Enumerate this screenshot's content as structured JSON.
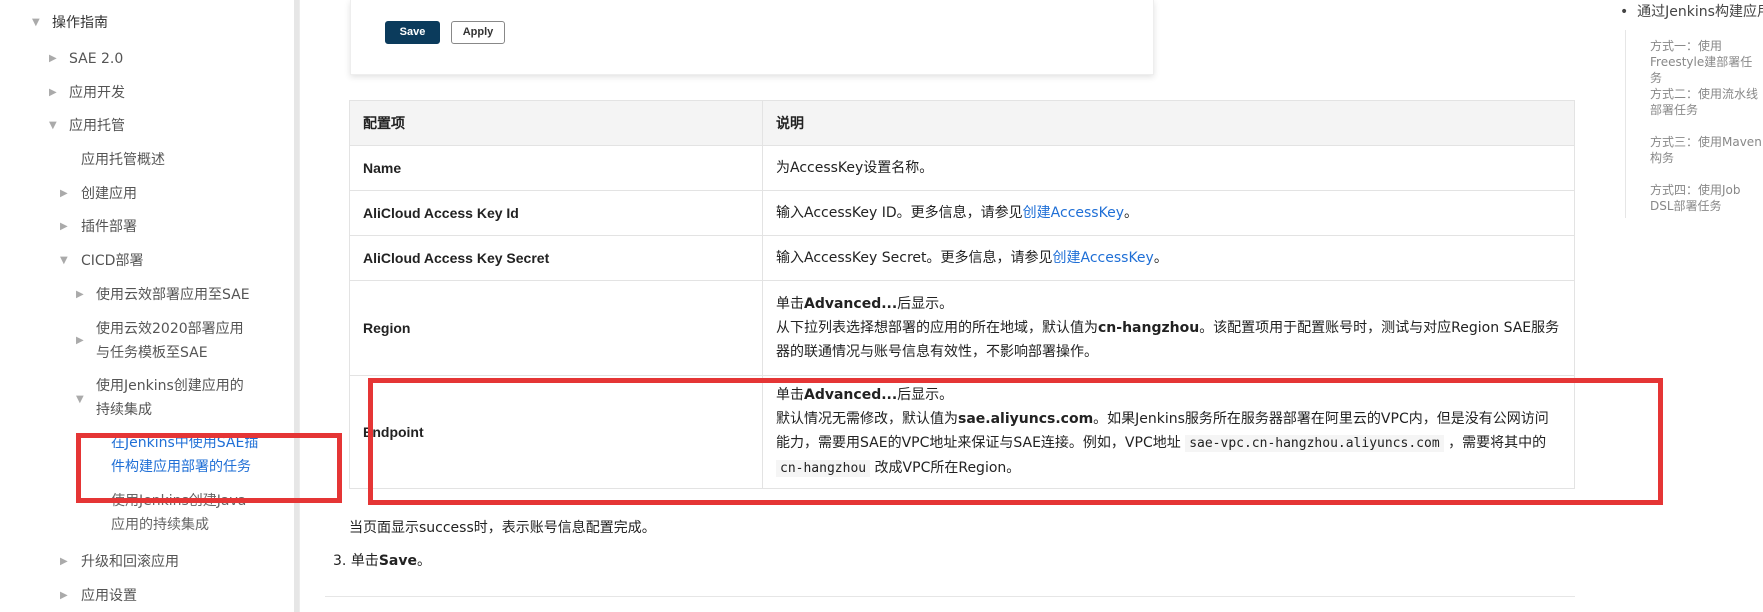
{
  "sidebar": {
    "items": [
      {
        "label": "操作指南",
        "caret": "▼"
      },
      {
        "label": "SAE 2.0",
        "caret": "▶"
      },
      {
        "label": "应用开发",
        "caret": "▶"
      },
      {
        "label": "应用托管",
        "caret": "▼"
      },
      {
        "label": "应用托管概述",
        "caret": ""
      },
      {
        "label": "创建应用",
        "caret": "▶"
      },
      {
        "label": "插件部署",
        "caret": "▶"
      },
      {
        "label": "CICD部署",
        "caret": "▼"
      },
      {
        "label": "使用云效部署应用至SAE",
        "caret": "▶"
      },
      {
        "label": "使用云效2020部署应用与任务模板至SAE",
        "caret": "▶"
      },
      {
        "label": "使用Jenkins创建应用的持续集成",
        "caret": "▼"
      },
      {
        "label": "在Jenkins中使用SAE插件构建应用部署的任务",
        "caret": ""
      },
      {
        "label": "使用Jenkins创建Java应用的持续集成",
        "caret": ""
      },
      {
        "label": "升级和回滚应用",
        "caret": "▶"
      },
      {
        "label": "应用设置",
        "caret": "▶"
      }
    ]
  },
  "form": {
    "save_label": "Save",
    "apply_label": "Apply"
  },
  "table": {
    "headers": [
      "配置项",
      "说明"
    ],
    "rows": [
      {
        "key": "Name",
        "desc": "为AccessKey设置名称。"
      },
      {
        "key": "AliCloud Access Key Id",
        "desc_pre": "输入AccessKey ID。更多信息，请参见",
        "desc_link": "创建AccessKey",
        "desc_post": "。"
      },
      {
        "key": "AliCloud Access Key Secret",
        "desc_pre": "输入AccessKey Secret。更多信息，请参见",
        "desc_link": "创建AccessKey",
        "desc_post": "。"
      },
      {
        "key": "Region",
        "l1_pre": "单击",
        "l1_bold": "Advanced...",
        "l1_post": "后显示。",
        "l2_pre": "从下拉列表选择想部署的应用的所在地域，默认值为",
        "l2_bold": "cn-hangzhou",
        "l2_post": "。该配置项用于配置账号时，测试与对应Region SAE服务器的联通情况与账号信息有效性，不影响部署操作。"
      },
      {
        "key": "Endpoint",
        "l1_pre": "单击",
        "l1_bold": "Advanced...",
        "l1_post": "后显示。",
        "l2_pre": "默认情况无需修改，默认值为",
        "l2_bold": "sae.aliyuncs.com",
        "l2_mid": "。如果Jenkins服务所在服务器部署在阿里云的VPC内，但是没有公网访问能力，需要用SAE的VPC地址来保证与SAE连接。例如，VPC地址",
        "l2_code1": "sae-vpc.cn-hangzhou.aliyuncs.com",
        "l2_mid2": "，需要将其中的",
        "l2_code2": "cn-hangzhou",
        "l2_post": "改成VPC所在Region。"
      }
    ]
  },
  "note": "当页面显示success时，表示账号信息配置完成。",
  "step3": {
    "num": "3.",
    "pre": "单击",
    "bold": "Save",
    "post": "。"
  },
  "toc": {
    "head": "通过Jenkins构建应用",
    "items": [
      "方式一：使用Freestyle建部署任务",
      "方式二：使用流水线部署任务",
      "方式三：使用Maven构务",
      "方式四：使用Job DSL部署任务"
    ]
  },
  "colors": {
    "annotation": "#e53535",
    "link": "#1f6fd6",
    "save_button": "#0b3b5c"
  }
}
